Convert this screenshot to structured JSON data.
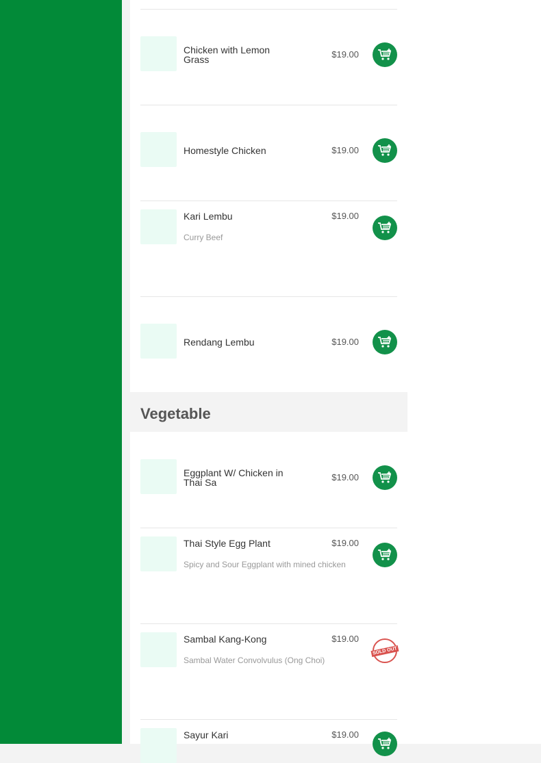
{
  "category": {
    "title": "Vegetable"
  },
  "items": [
    {
      "name": "Chicken with Lemon Grass",
      "price": "$19.00",
      "desc": "",
      "sold_out": false
    },
    {
      "name": "Homestyle Chicken",
      "price": "$19.00",
      "desc": "",
      "sold_out": false
    },
    {
      "name": "Kari Lembu",
      "price": "$19.00",
      "desc": "Curry Beef",
      "sold_out": false
    },
    {
      "name": "Rendang Lembu",
      "price": "$19.00",
      "desc": "",
      "sold_out": false
    },
    {
      "name": "Eggplant W/ Chicken in Thai Sa",
      "price": "$19.00",
      "desc": "",
      "sold_out": false
    },
    {
      "name": "Thai Style Egg Plant",
      "price": "$19.00",
      "desc": "Spicy and Sour Eggplant with mined chicken",
      "sold_out": false
    },
    {
      "name": "Sambal Kang-Kong",
      "price": "$19.00",
      "desc": "Sambal Water Convolvulus (Ong Choi)",
      "sold_out": true,
      "sold_out_label": "SOLD OUT"
    },
    {
      "name": "Sayur Kari",
      "price": "$19.00",
      "desc": "",
      "sold_out": false
    }
  ],
  "icons": {
    "cart": "add-to-cart-icon",
    "sold_out": "sold-out-stamp-icon"
  },
  "colors": {
    "sidebar": "#028a38",
    "cart_button": "#12914a",
    "sold_out": "#d9534f",
    "thumb": "#eafbf4"
  }
}
